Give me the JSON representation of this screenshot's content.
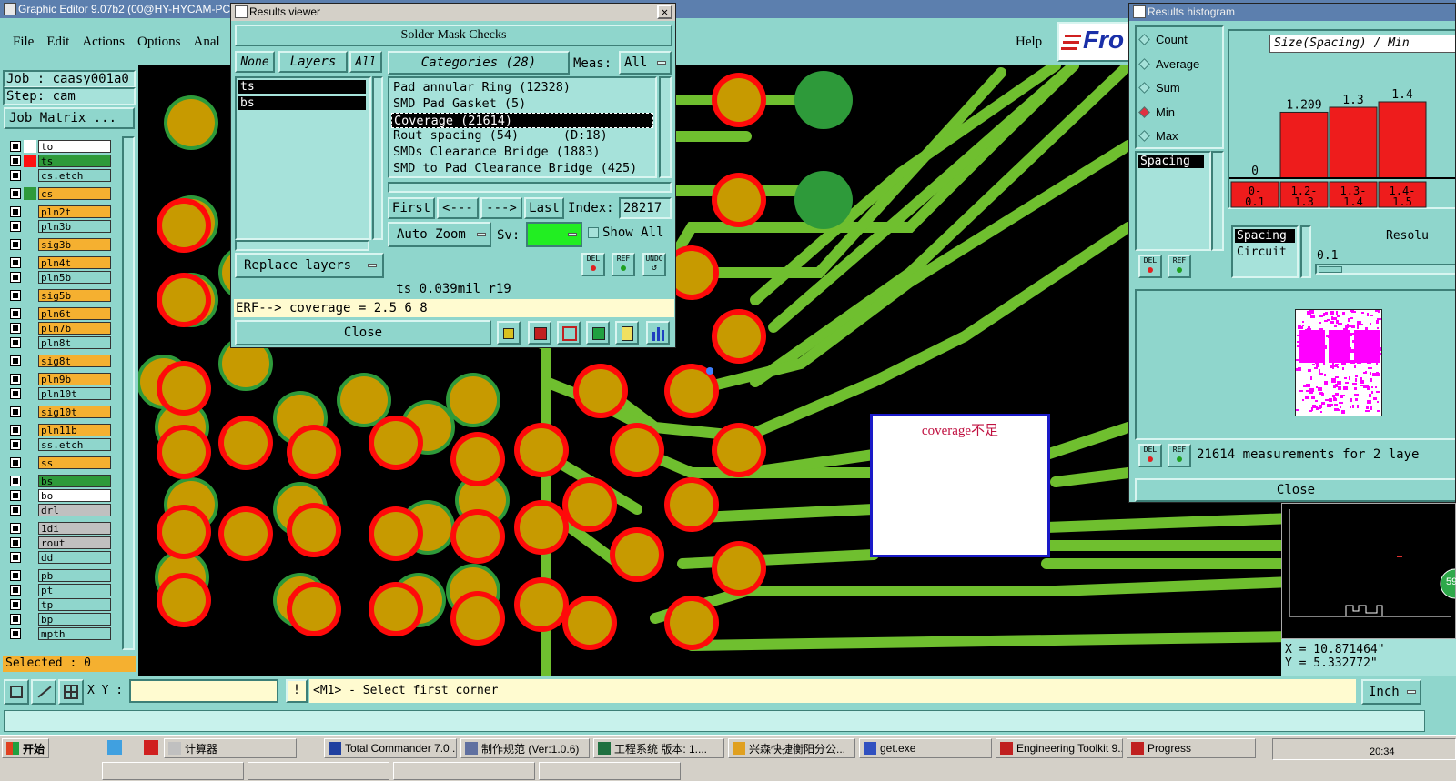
{
  "main_window": {
    "title": "Graphic Editor 9.07b2 (00@HY-HYCAM-PC1",
    "menu": [
      "File",
      "Edit",
      "Actions",
      "Options",
      "Anal"
    ],
    "help": "Help",
    "logo": "Fro"
  },
  "job": {
    "job_label": "Job : caasy001a0",
    "step_label": "Step: cam",
    "matrix_button": "Job Matrix ..."
  },
  "layers": [
    {
      "name": "to",
      "color": "#ffffff",
      "sw": "#ffffff"
    },
    {
      "name": "ts",
      "color": "#2e9a3a",
      "sw": "#ff1010"
    },
    {
      "name": "cs.etch",
      "color": "#8fd6cc",
      "sw": "#8fd6cc"
    },
    {
      "name": "cs",
      "color": "#f5b030",
      "sw": "#2e9a3a"
    },
    {
      "name": "pln2t",
      "color": "#f5b030",
      "sw": "#8fd6cc"
    },
    {
      "name": "pln3b",
      "color": "#8fd6cc",
      "sw": "#8fd6cc"
    },
    {
      "name": "sig3b",
      "color": "#f5b030",
      "sw": "#8fd6cc"
    },
    {
      "name": "pln4t",
      "color": "#f5b030",
      "sw": "#8fd6cc"
    },
    {
      "name": "pln5b",
      "color": "#8fd6cc",
      "sw": "#8fd6cc"
    },
    {
      "name": "sig5b",
      "color": "#f5b030",
      "sw": "#8fd6cc"
    },
    {
      "name": "pln6t",
      "color": "#f5b030",
      "sw": "#8fd6cc"
    },
    {
      "name": "pln7b",
      "color": "#f5b030",
      "sw": "#8fd6cc"
    },
    {
      "name": "pln8t",
      "color": "#8fd6cc",
      "sw": "#8fd6cc"
    },
    {
      "name": "sig8t",
      "color": "#f5b030",
      "sw": "#8fd6cc"
    },
    {
      "name": "pln9b",
      "color": "#f5b030",
      "sw": "#8fd6cc"
    },
    {
      "name": "pln10t",
      "color": "#8fd6cc",
      "sw": "#8fd6cc"
    },
    {
      "name": "sig10t",
      "color": "#f5b030",
      "sw": "#8fd6cc"
    },
    {
      "name": "pln11b",
      "color": "#f5b030",
      "sw": "#8fd6cc"
    },
    {
      "name": "ss.etch",
      "color": "#8fd6cc",
      "sw": "#8fd6cc"
    },
    {
      "name": "ss",
      "color": "#f5b030",
      "sw": "#8fd6cc"
    },
    {
      "name": "bs",
      "color": "#2e9a3a",
      "sw": "#8fd6cc"
    },
    {
      "name": "bo",
      "color": "#ffffff",
      "sw": "#8fd6cc"
    },
    {
      "name": "drl",
      "color": "#c0c0c0",
      "sw": "#8fd6cc"
    },
    {
      "name": "1di",
      "color": "#c0c0c0",
      "sw": "#8fd6cc"
    },
    {
      "name": "rout",
      "color": "#c0c0c0",
      "sw": "#8fd6cc"
    },
    {
      "name": "dd",
      "color": "#8fd6cc",
      "sw": "#8fd6cc"
    },
    {
      "name": "pb",
      "color": "#8fd6cc",
      "sw": "#8fd6cc"
    },
    {
      "name": "pt",
      "color": "#8fd6cc",
      "sw": "#8fd6cc"
    },
    {
      "name": "tp",
      "color": "#8fd6cc",
      "sw": "#8fd6cc"
    },
    {
      "name": "bp",
      "color": "#8fd6cc",
      "sw": "#8fd6cc"
    },
    {
      "name": "mpth",
      "color": "#8fd6cc",
      "sw": "#8fd6cc"
    }
  ],
  "selected_label": "Selected : 0",
  "results_viewer": {
    "title": "Results viewer",
    "header": "Solder Mask Checks",
    "none": "None",
    "layers": "Layers",
    "all": "All",
    "categories": "Categories (28)",
    "meas_label": "Meas:",
    "meas_value": "All",
    "layer_items": [
      "ts",
      "bs"
    ],
    "cat_items": [
      "Pad annular Ring (12328)",
      "SMD Pad Gasket (5)",
      "Coverage (21614)",
      "Rout spacing (54)      (D:18)",
      "SMDs Clearance Bridge (1883)",
      "SMD to Pad Clearance Bridge (425)"
    ],
    "first": "First",
    "prev": "<---",
    "next": "--->",
    "last": "Last",
    "index_label": "Index:",
    "index_value": "28217",
    "auto_zoom": "Auto Zoom",
    "sv_label": "Sv:",
    "show_all": "Show All",
    "replace_layers": "Replace layers",
    "del": "DEL",
    "ref": "REF",
    "undo": "UNDO",
    "status": "ts 0.039mil   r19",
    "erf": "ERF--> coverage = 2.5 6 8",
    "close": "Close"
  },
  "histogram": {
    "title": "Results histogram",
    "options": [
      "Count",
      "Average",
      "Sum",
      "Min",
      "Max"
    ],
    "selected_option": "Min",
    "size_title": "Size(Spacing) / Min",
    "bars": [
      {
        "label": "0-\n0.1",
        "value": "0"
      },
      {
        "label": "1.2-\n1.3",
        "value": "1.209"
      },
      {
        "label": "1.3-\n1.4",
        "value": "1.3"
      },
      {
        "label": "1.4-\n1.5",
        "value": "1.4"
      }
    ],
    "list_item": "Spacing",
    "spacing_circuit": [
      "Spacing",
      "Circuit"
    ],
    "resol_label": "Resolu",
    "resol_value": "0.1",
    "del": "DEL",
    "ref": "REF",
    "measurements": "21614 measurements for 2 laye",
    "close": "Close"
  },
  "canvas": {
    "annotation": "coverage不足",
    "coord_x": "X = 10.871464\"",
    "coord_y": "Y = 5.332772\"",
    "badge": "59"
  },
  "bottom": {
    "xy_label": "X Y :",
    "xy_value": "",
    "prompt": "<M1> - Select first corner",
    "units": "Inch"
  },
  "taskbar": {
    "start": "开始",
    "items": [
      "计算器",
      "Total Commander 7.0 ...",
      "制作规范 (Ver:1.0.6)",
      "工程系统  版本: 1....",
      "兴森快捷衡阳分公...",
      "get.exe",
      "Engineering Toolkit 9....",
      "Progress"
    ],
    "clock": "20:34"
  }
}
